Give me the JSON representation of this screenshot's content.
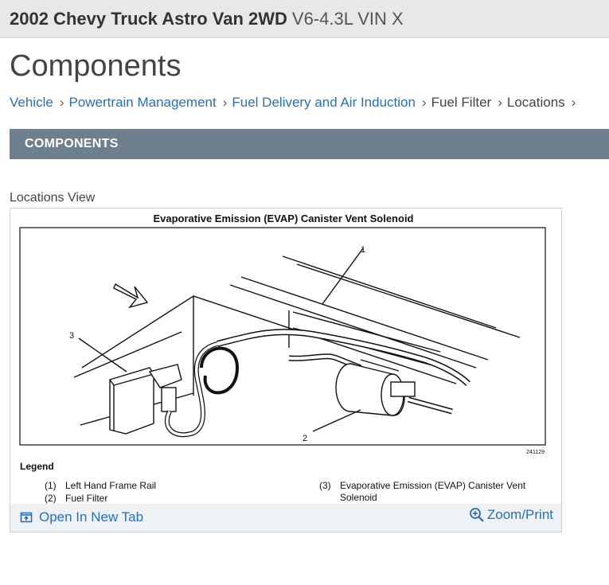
{
  "header": {
    "vehicle_title": "2002 Chevy Truck Astro Van 2WD",
    "engine": "V6-4.3L VIN X"
  },
  "page": {
    "title": "Components"
  },
  "breadcrumb": [
    {
      "label": "Vehicle",
      "link": true
    },
    {
      "label": "Powertrain Management",
      "link": true
    },
    {
      "label": "Fuel Delivery and Air Induction",
      "link": true
    },
    {
      "label": "Fuel Filter",
      "link": false
    },
    {
      "label": "Locations",
      "link": false
    }
  ],
  "section": {
    "title": "COMPONENTS"
  },
  "figure": {
    "view_label": "Locations View",
    "diagram_title": "Evaporative Emission (EVAP) Canister Vent Solenoid",
    "callouts": [
      "1",
      "2",
      "3"
    ],
    "figure_number": "241129",
    "legend_title": "Legend",
    "legend": [
      {
        "num": "(1)",
        "text": "Left Hand Frame Rail"
      },
      {
        "num": "(2)",
        "text": "Fuel Filter"
      },
      {
        "num": "(3)",
        "text_line1": "Evaporative Emission (EVAP) Canister Vent",
        "text_line2": "Solenoid"
      }
    ],
    "open_tab_label": "Open In New Tab",
    "zoom_label": "Zoom/Print"
  },
  "icons": {
    "open_tab": "open-new-tab-icon",
    "zoom": "magnifier-plus-icon"
  },
  "colors": {
    "link": "#2a6fb0",
    "section_bar": "#6f7f8e",
    "topbar": "#e8e8e8"
  }
}
